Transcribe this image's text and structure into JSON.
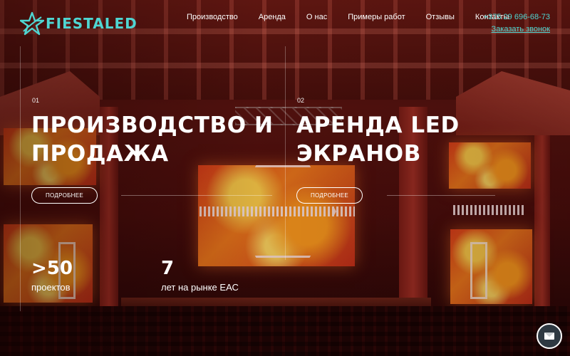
{
  "brand": {
    "logo_text": "FIESTALED",
    "accent_color": "#4fd6d2"
  },
  "nav": {
    "items": [
      {
        "label": "Производство"
      },
      {
        "label": "Аренда"
      },
      {
        "label": "О нас"
      },
      {
        "label": "Примеры работ"
      },
      {
        "label": "Отзывы"
      },
      {
        "label": "Контакты"
      }
    ]
  },
  "contacts": {
    "phone": "+375 29 696-68-73",
    "callback_label": "Заказать звонок"
  },
  "hero": {
    "blocks": [
      {
        "number": "01",
        "title_line1": "ПРОИЗВОДСТВО И",
        "title_line2": "ПРОДАЖА",
        "button_label": "ПОДРОБНЕЕ"
      },
      {
        "number": "02",
        "title_line1": "АРЕНДА LED",
        "title_line2": "ЭКРАНОВ",
        "button_label": "ПОДРОБНЕЕ"
      }
    ]
  },
  "stats": [
    {
      "value": ">50",
      "label": "проектов"
    },
    {
      "value": "7",
      "label": "лет на рынке ЕАС"
    }
  ],
  "fab": {
    "icon": "mail-icon"
  }
}
